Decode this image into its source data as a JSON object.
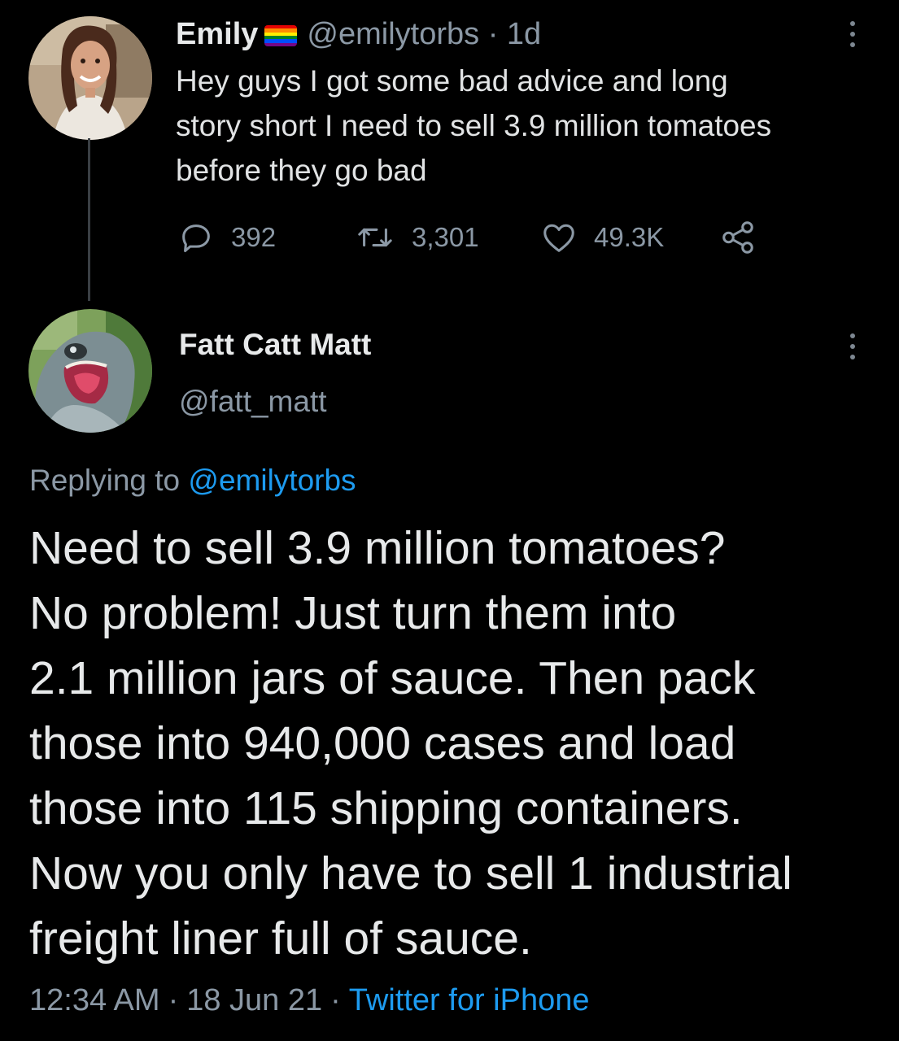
{
  "tweet1": {
    "author_name": "Emily",
    "author_handle": "@emilytorbs",
    "dot": "·",
    "age": "1d",
    "text": "Hey guys I got some bad advice and long\nstory short I need to sell 3.9 million tomatoes\nbefore they go bad",
    "replies": "392",
    "retweets": "3,301",
    "likes": "49.3K",
    "flag_icon": "rainbow-flag-emoji",
    "flag_colors": [
      "#e40303",
      "#ff8c00",
      "#ffed00",
      "#008026",
      "#004dff",
      "#750787"
    ]
  },
  "tweet2": {
    "author_name": "Fatt Catt Matt",
    "author_handle": "@fatt_matt",
    "replying_prefix": "Replying to",
    "replying_to": "@emilytorbs",
    "text": "Need to sell 3.9 million tomatoes?\nNo problem! Just turn them into\n2.1 million jars of sauce. Then pack\nthose into 940,000 cases and load\nthose into 115 shipping containers.\nNow you only have to sell 1 industrial\nfreight liner full of sauce.",
    "time": "12:34 AM",
    "dot": "·",
    "date": "18 Jun 21",
    "source": "Twitter for iPhone"
  },
  "icons": {
    "reply": "reply-icon",
    "retweet": "retweet-icon",
    "like": "heart-icon",
    "share": "share-icon",
    "more": "more-options-icon"
  },
  "colors": {
    "background": "#000000",
    "muted_text": "#8b98a5",
    "link": "#1d9bf0",
    "primary_text": "#e7e9ea"
  }
}
